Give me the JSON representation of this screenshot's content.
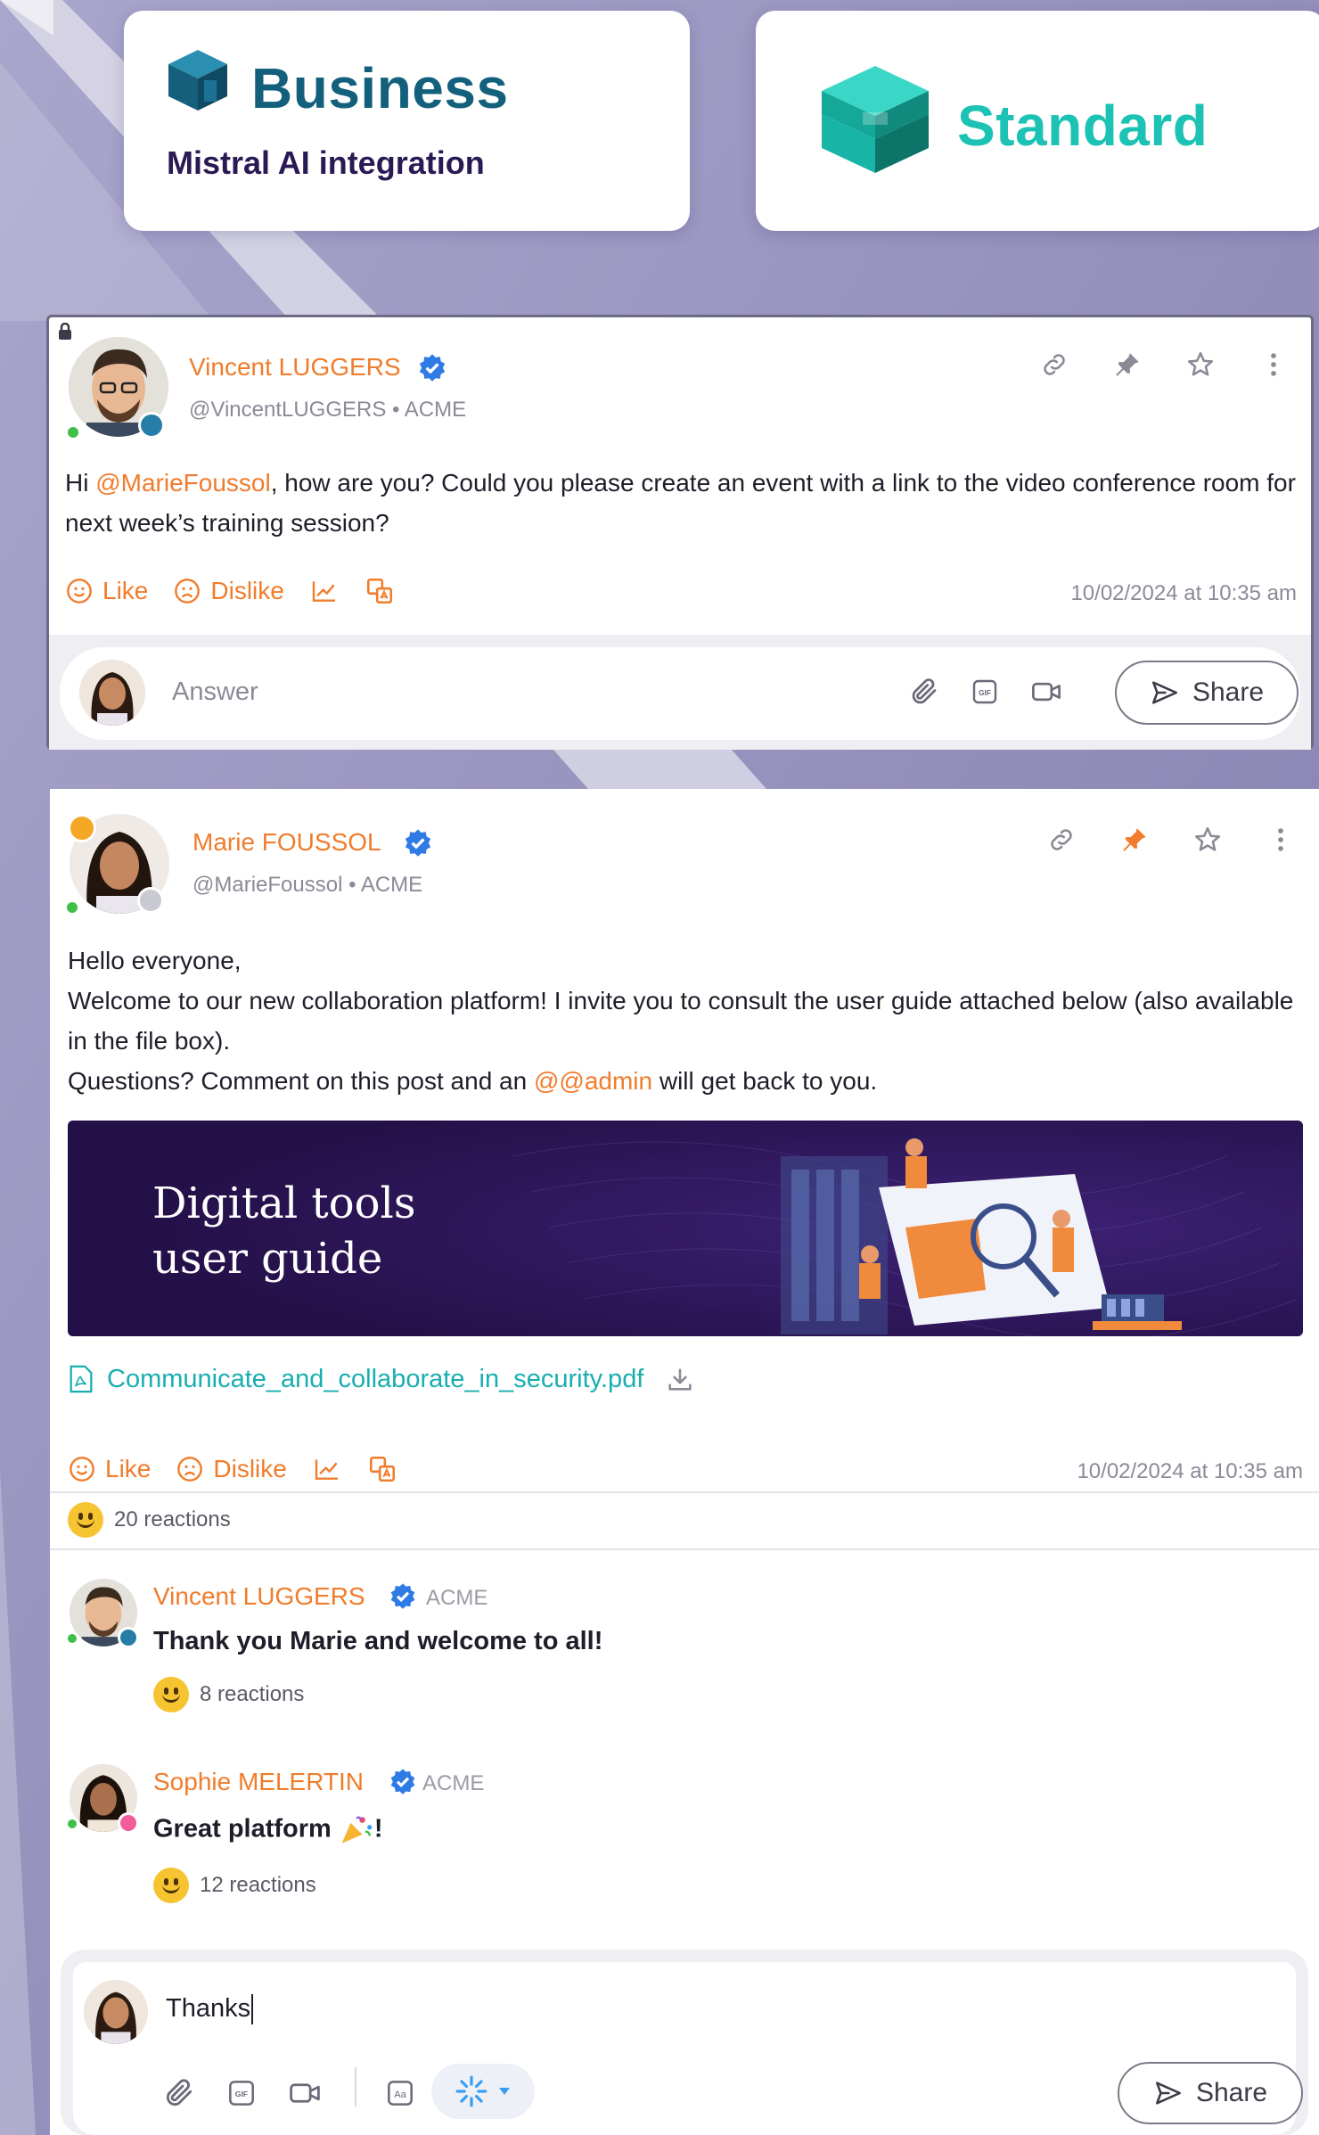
{
  "badges": {
    "business": {
      "title": "Business",
      "subtitle": "Mistral AI integration"
    },
    "standard": {
      "title": "Standard"
    }
  },
  "post1": {
    "author": "Vincent LUGGERS",
    "handle": "@VincentLUGGERS",
    "org": "• ACME",
    "text_before": "Hi ",
    "mention": "@MarieFoussol",
    "text_after": ", how are you? Could you please create an event with a link to the video conference room for next week’s training session?",
    "like_label": "Like",
    "dislike_label": "Dislike",
    "timestamp": "10/02/2024 at 10:35 am",
    "answer_placeholder": "Answer",
    "share_label": "Share"
  },
  "post2": {
    "author": "Marie FOUSSOL",
    "handle": "@MarieFoussol",
    "org": "• ACME",
    "line1": "Hello everyone,",
    "line2": "Welcome to our new collaboration platform! I invite you to consult the user guide attached below (also available in the file box).",
    "line3_before": "Questions? Comment on this post and an ",
    "line3_mention": "@@admin",
    "line3_after": " will get back to you.",
    "banner_line1": "Digital tools",
    "banner_line2": "user guide",
    "file_name": "Communicate_and_collaborate_in_security.pdf",
    "like_label": "Like",
    "dislike_label": "Dislike",
    "timestamp": "10/02/2024 at 10:35 am",
    "reactions": "20 reactions",
    "comments": [
      {
        "author": "Vincent LUGGERS",
        "org": "ACME",
        "text": "Thank you Marie and welcome to all!",
        "reactions": "8 reactions"
      },
      {
        "author": "Sophie MELERTIN",
        "org": "ACME",
        "text": "Great platform",
        "text_suffix": "!",
        "reactions": "12 reactions"
      }
    ],
    "composer_value": "Thanks",
    "share_label": "Share"
  },
  "colors": {
    "accent": "#f07c2c",
    "business": "#13607c",
    "standard": "#1cc2b4",
    "verified": "#2f7be6",
    "link": "#19aeb0"
  },
  "icons": [
    "link-icon",
    "pin-icon",
    "star-icon",
    "more-icon",
    "smile-icon",
    "frown-icon",
    "stats-icon",
    "translate-icon",
    "paperclip-icon",
    "gif-icon",
    "video-icon",
    "send-icon",
    "pdf-icon",
    "download-icon",
    "text-format-icon",
    "ai-sparkle-icon",
    "lock-icon",
    "verified-icon"
  ]
}
